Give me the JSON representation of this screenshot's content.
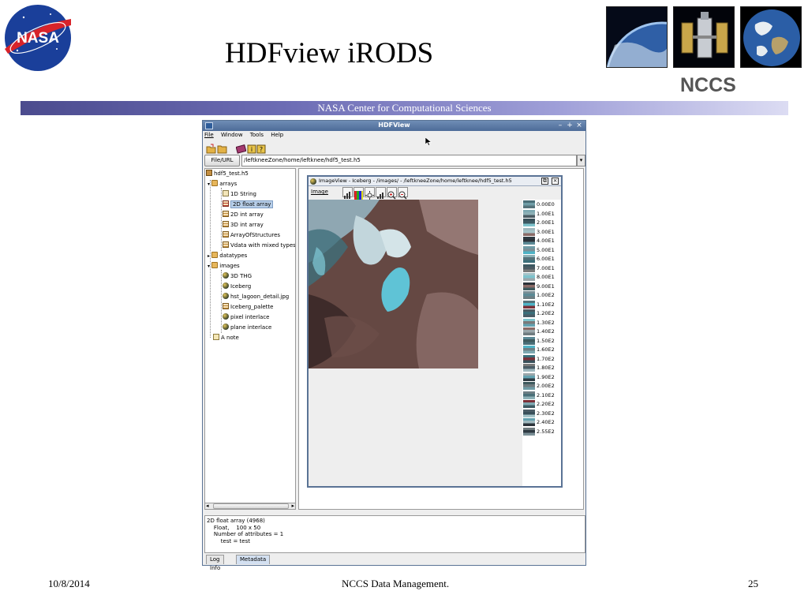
{
  "slide": {
    "title": "HDFview iRODS",
    "banner_text": "NASA Center for Computational Sciences",
    "ncc_logo_text": "NCCS",
    "nasa_logo_text": "NASA",
    "footer_date": "10/8/2014",
    "footer_center": "NCCS Data Management.",
    "footer_page": "25"
  },
  "window": {
    "title": "HDFView",
    "menus": [
      "File",
      "Window",
      "Tools",
      "Help"
    ],
    "url_button": "File/URL",
    "url_value": "/leftkneeZone/home/leftknee/hdf5_test.h5"
  },
  "tree": [
    {
      "label": "hdf5_test.h5",
      "icon": "db-icon"
    },
    {
      "label": "arrays",
      "icon": "folder-icon"
    },
    {
      "label": "1D String",
      "icon": "file-icon"
    },
    {
      "label": "2D float array",
      "icon": "table-icon",
      "selected": true
    },
    {
      "label": "2D int array",
      "icon": "table-icon"
    },
    {
      "label": "3D int array",
      "icon": "table-icon"
    },
    {
      "label": "ArrayOfStructures",
      "icon": "table-icon"
    },
    {
      "label": "Vdata with mixed types",
      "icon": "table-icon"
    },
    {
      "label": "datatypes",
      "icon": "folder-icon"
    },
    {
      "label": "images",
      "icon": "folder-icon"
    },
    {
      "label": "3D THG",
      "icon": "globe-icon"
    },
    {
      "label": "Iceberg",
      "icon": "globe-icon"
    },
    {
      "label": "hst_lagoon_detail.jpg",
      "icon": "globe-icon"
    },
    {
      "label": "Iceberg_palette",
      "icon": "table-icon"
    },
    {
      "label": "pixel interlace",
      "icon": "globe-icon"
    },
    {
      "label": "plane interlace",
      "icon": "globe-icon"
    },
    {
      "label": "A note",
      "icon": "note-icon"
    }
  ],
  "image_view": {
    "title": "ImageView  -  Iceberg  -  /images/  -  /leftkneeZone/home/leftknee/hdf5_test.h5",
    "menu": "Image"
  },
  "colorbar": {
    "labels": [
      "0.00E0",
      "1.00E1",
      "2.00E1",
      "3.00E1",
      "4.00E1",
      "5.00E1",
      "6.00E1",
      "7.00E1",
      "8.00E1",
      "9.00E1",
      "1.00E2",
      "1.10E2",
      "1.20E2",
      "1.30E2",
      "1.40E2",
      "1.50E2",
      "1.60E2",
      "1.70E2",
      "1.80E2",
      "1.90E2",
      "2.00E2",
      "2.10E2",
      "2.20E2",
      "2.30E2",
      "2.40E2",
      "2.55E2"
    ],
    "colors": [
      "#4a6f78",
      "#7ea9b2",
      "#38505a",
      "#9fb8be",
      "#2e3a42",
      "#6f9ca6",
      "#8db0b6",
      "#3c5962",
      "#a4c3c8",
      "#2b3239",
      "#7a8f96",
      "#55727a",
      "#4a5a62",
      "#7ec3cc",
      "#8a6a66",
      "#5c8a96",
      "#4fb3c6",
      "#3b6e7a",
      "#7a7a7a",
      "#9aa6aa",
      "#3e5a5e",
      "#6e7f84",
      "#7a3038",
      "#4a5c66",
      "#63a2b0",
      "#6f7b7f"
    ]
  },
  "info_panel": {
    "lines": [
      "2D float array (4968)",
      "    Float,    100 x 50",
      "    Number of attributes = 1",
      "        test = test"
    ]
  },
  "tabs": [
    "Log Info",
    "Metadata"
  ],
  "colors": {
    "banner_start": "#4b4b8e",
    "window_border": "#5a7395",
    "selection": "#b8cfe9"
  }
}
